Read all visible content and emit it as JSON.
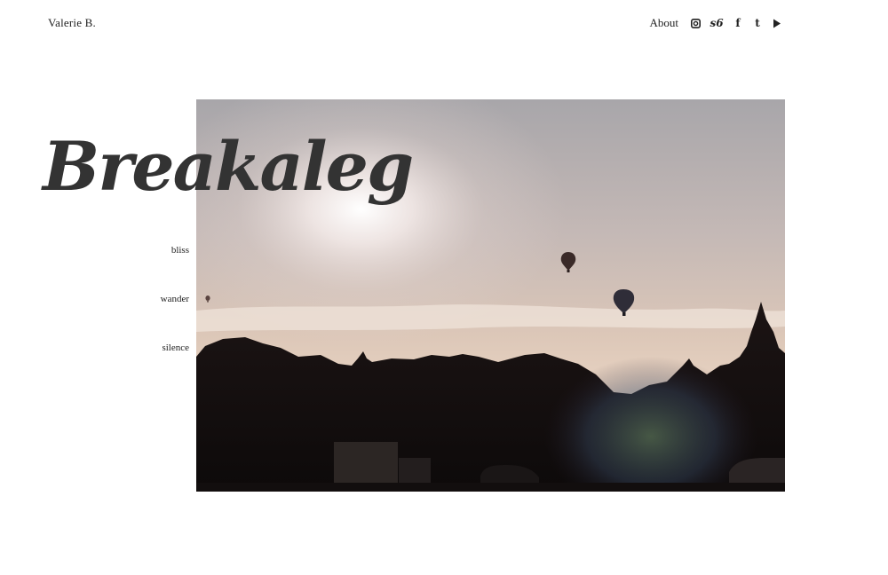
{
  "site": {
    "brand": "Valerie B.",
    "title": "Breakaleg"
  },
  "nav": {
    "about": "About",
    "social": [
      {
        "name": "instagram-icon",
        "glyph": ""
      },
      {
        "name": "s6-icon",
        "glyph": "s6"
      },
      {
        "name": "facebook-icon",
        "glyph": "f"
      },
      {
        "name": "tumblr-icon",
        "glyph": "t"
      },
      {
        "name": "play-icon",
        "glyph": ""
      }
    ]
  },
  "sidebar": {
    "items": [
      {
        "label": "bliss"
      },
      {
        "label": "wander"
      },
      {
        "label": "silence"
      }
    ]
  },
  "hero": {
    "scene": "sunset-sky-hot-air-balloons-treeline"
  },
  "colors": {
    "text": "#222222",
    "title": "#333333",
    "background": "#ffffff"
  }
}
